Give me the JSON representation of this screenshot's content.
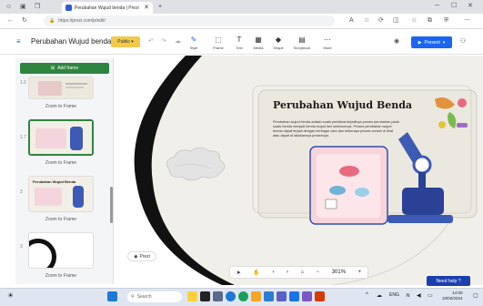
{
  "browser": {
    "tab_title": "Perubahan Wujud benda | Prezi",
    "url": "https://prezi.com/p/edit/",
    "tab_close": "✕",
    "new_tab": "+"
  },
  "toolbar": {
    "presentation_title": "Perubahan Wujud benda",
    "public_label": "Public",
    "tools": [
      {
        "label": "Style"
      },
      {
        "label": "Frame"
      },
      {
        "label": "Text"
      },
      {
        "label": "Media"
      },
      {
        "label": "Shape"
      },
      {
        "label": "Storyblock"
      },
      {
        "label": "More"
      }
    ],
    "present_label": "Present"
  },
  "panel": {
    "add_frame_label": "Add frame",
    "frames": [
      {
        "number": "1.6",
        "label": "Zoom to Frame"
      },
      {
        "number": "1.7",
        "label": "Zoom to Frame"
      },
      {
        "number": "2",
        "label": "Zoom to Frame"
      },
      {
        "number": "3",
        "label": "Zoom to Frame"
      }
    ],
    "thumb3_title": "Perubahan Wujud Benda"
  },
  "slide": {
    "title": "Perubahan Wujud Benda",
    "body": "Perubahan wujud benda adalah suatu peristiwa terjadinya proses perubahan pada suatu benda menjadi benda wujud lain sebelumnya. Proses perubahan wujud benda dapat terjadi dengan berbagai cara dan beberapa proses contoh di lihat atau dapat di lakukannya prosesnya."
  },
  "canvas": {
    "prezi_logo_label": "Prezi",
    "zoom_label": "301%",
    "need_help_label": "Need help"
  },
  "taskbar": {
    "search_placeholder": "Search",
    "time": "14:00",
    "date": "10/03/2024"
  },
  "colors": {
    "prezi_blue": "#1c64f2",
    "public_yellow": "#f2c94c",
    "add_frame_green": "#2e8540"
  }
}
